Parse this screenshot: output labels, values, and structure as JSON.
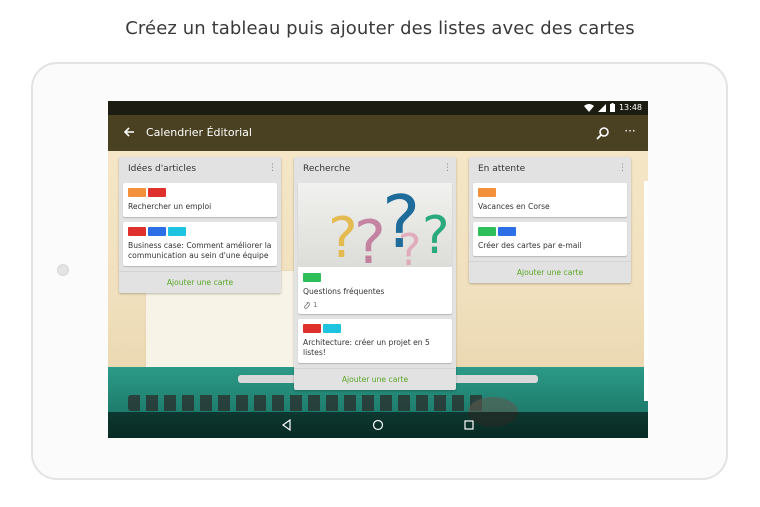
{
  "headline": "Créez un tableau puis ajouter des listes avec des cartes",
  "status_bar": {
    "time": "13:48"
  },
  "app_bar": {
    "title": "Calendrier Éditorial",
    "back_icon": "arrow-left-icon",
    "search_icon": "search-icon",
    "more_icon": "more-vert-icon"
  },
  "colors": {
    "app_bar": "#4a4122",
    "status_bar": "#1d1c12",
    "add_card_text": "#5aa626",
    "list_bg": "#e2e2e2",
    "label_orange": "#f2913a",
    "label_red": "#e0302c",
    "label_blue": "#2b6ee5",
    "label_cyan": "#1ec4df",
    "label_green": "#2fbf5a"
  },
  "lists": [
    {
      "title": "Idées d'articles",
      "add_label": "Ajouter une carte",
      "cards": [
        {
          "title": "Rechercher un emploi",
          "labels": [
            "#f2913a",
            "#e0302c"
          ]
        },
        {
          "title": "Business case: Comment améliorer la communication au sein d'une équipe",
          "labels": [
            "#e0302c",
            "#2b6ee5",
            "#1ec4df"
          ]
        }
      ]
    },
    {
      "title": "Recherche",
      "add_label": "Ajouter une carte",
      "cards": [
        {
          "title": "Questions fréquentes",
          "labels": [
            "#2fbf5a"
          ],
          "attachments": "1",
          "has_cover": true
        },
        {
          "title": "Architecture: créer un projet en 5 listes!",
          "labels": [
            "#e0302c",
            "#1ec4df"
          ]
        }
      ]
    },
    {
      "title": "En attente",
      "add_label": "Ajouter une carte",
      "cards": [
        {
          "title": "Vacances en Corse",
          "labels": [
            "#f2913a"
          ]
        },
        {
          "title": "Créer des cartes par e-mail",
          "labels": [
            "#2fbf5a",
            "#2b6ee5"
          ]
        }
      ]
    }
  ],
  "nav_bar": {
    "back": "nav-back-icon",
    "home": "nav-home-icon",
    "recents": "nav-recents-icon"
  }
}
